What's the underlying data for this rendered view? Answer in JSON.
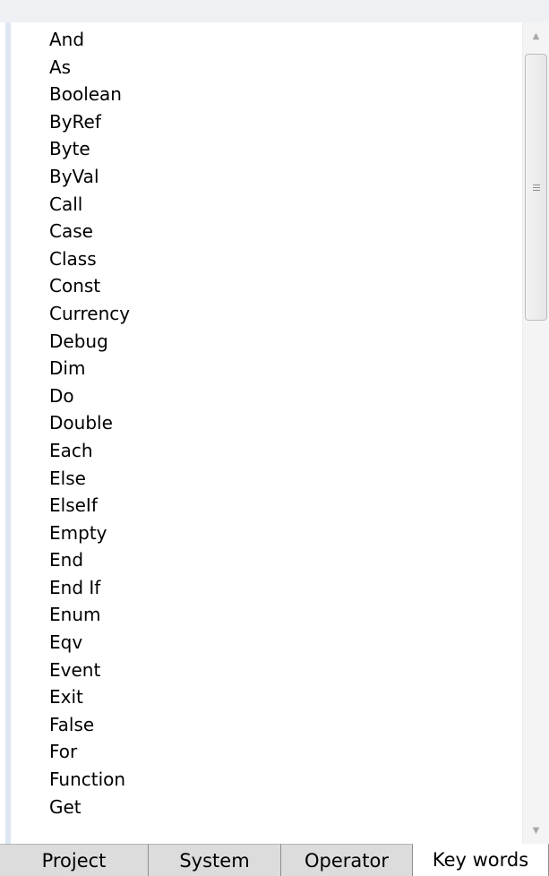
{
  "keywords": [
    "And",
    "As",
    "Boolean",
    "ByRef",
    "Byte",
    "ByVal",
    "Call",
    "Case",
    "Class",
    "Const",
    "Currency",
    "Debug",
    "Dim",
    "Do",
    "Double",
    "Each",
    "Else",
    "ElseIf",
    "Empty",
    "End",
    "End If",
    "Enum",
    "Eqv",
    "Event",
    "Exit",
    "False",
    "For",
    "Function",
    "Get"
  ],
  "scrollbar": {
    "up_icon": "triangle-up",
    "down_icon": "triangle-down",
    "grip_icon": "grip-lines"
  },
  "tabs": [
    {
      "label": "Project",
      "active": false
    },
    {
      "label": "System",
      "active": false
    },
    {
      "label": "Operator",
      "active": false
    },
    {
      "label": "Key words",
      "active": true
    }
  ],
  "colors": {
    "tab_inactive": "#dcdcdc",
    "tab_active": "#ffffff",
    "panel_edge": "#dde6f2"
  }
}
